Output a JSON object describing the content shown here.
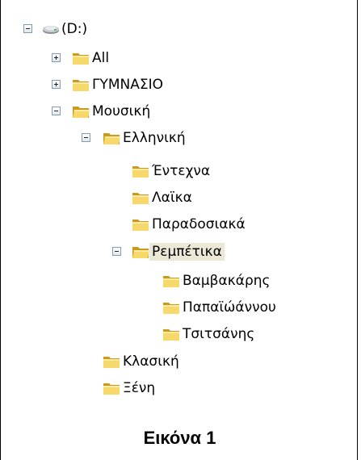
{
  "tree": {
    "root": {
      "label": "(D:)",
      "icon": "drive-icon",
      "expanded": true
    },
    "all": {
      "label": "All",
      "icon": "folder-icon",
      "expanded": false
    },
    "gymnasio": {
      "label": "ΓΥΜΝΑΣΙΟ",
      "icon": "folder-icon",
      "expanded": false
    },
    "mousiki": {
      "label": "Μουσική",
      "icon": "folder-icon",
      "expanded": true
    },
    "elliniki": {
      "label": "Ελληνική",
      "icon": "folder-icon",
      "expanded": true
    },
    "entexna": {
      "label": "Έντεχνα",
      "icon": "folder-icon"
    },
    "laika": {
      "label": "Λαϊκα",
      "icon": "folder-icon"
    },
    "paradosiaka": {
      "label": "Παραδοσιακά",
      "icon": "folder-icon"
    },
    "rempetika": {
      "label": "Ρεμπέτικα",
      "icon": "folder-icon",
      "expanded": true,
      "selected": true
    },
    "vamvakaris": {
      "label": "Βαμβακάρης",
      "icon": "folder-icon"
    },
    "papaioannou": {
      "label": "Παπαϊώάννου",
      "icon": "folder-icon"
    },
    "tsitsanis": {
      "label": "Τσιτσάνης",
      "icon": "folder-icon"
    },
    "klasiki": {
      "label": "Κλασική",
      "icon": "folder-icon"
    },
    "xeni": {
      "label": "Ξένη",
      "icon": "folder-icon"
    }
  },
  "caption": "Εικόνα 1",
  "colors": {
    "folder_fill": "#f6d86b",
    "folder_dark": "#c99a1b",
    "selection_bg": "#ebe8d8",
    "toggle_border": "#7f9db9"
  }
}
